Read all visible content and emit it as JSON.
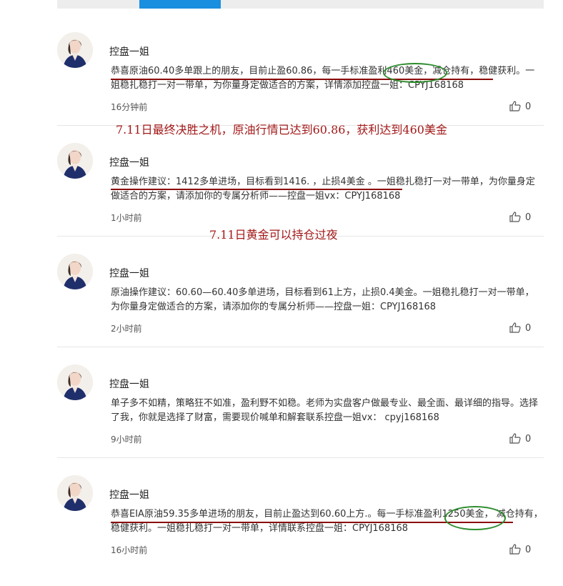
{
  "posts": [
    {
      "author": "控盘一姐",
      "content": "恭喜原油60.40多单跟上的朋友，目前止盈60.86，每一手标准盈利460美金，减仓持有，稳健获利。一姐稳扎稳打一对一带单，为你量身定做适合的方案，详情添加控盘一姐：CPYJ168168",
      "time": "16分钟前",
      "likes": "0"
    },
    {
      "author": "控盘一姐",
      "content": "黄金操作建议：1412多单进场，目标看到1416. ，止损4美金 。一姐稳扎稳打一对一带单，为你量身定做适合的方案，请添加你的专属分析师——控盘一姐vx：CPYJ168168",
      "time": "1小时前",
      "likes": "0"
    },
    {
      "author": "控盘一姐",
      "content": "原油操作建议：60.60—60.40多单进场，目标看到61上方，止损0.4美金。一姐稳扎稳打一对一带单，为你量身定做适合的方案，请添加你的专属分析师——控盘一姐：CPYJ168168",
      "time": "2小时前",
      "likes": "0"
    },
    {
      "author": "控盘一姐",
      "content": "单子多不如精，策略狂不如准，盈利野不如稳。老师为实盘客户做最专业、最全面、最详细的指导。选择了我，你就是选择了财富，需要现价喊单和解套联系控盘一姐vx： cpyj168168",
      "time": "9小时前",
      "likes": "0"
    },
    {
      "author": "控盘一姐",
      "content": "恭喜EIA原油59.35多单进场的朋友，目前止盈达到60.60上方.。每一手标准盈利1250美金， 减仓持有，稳健获利。一姐稳扎稳打一对一带单，详情联系控盘一姐：CPYJ168168",
      "time": "16小时前",
      "likes": "0"
    }
  ],
  "annotations": {
    "note1": "7.11日最终决胜之机，原油行情已达到60.86，获利达到460美金",
    "note2": "7.11日黄金可以持仓过夜"
  },
  "colors": {
    "accent_tab": "#1a8fe0",
    "annotation_red": "#8b0a0a",
    "annotation_green": "#2c8c2c"
  },
  "icons": {
    "like": "thumbs-up-icon",
    "avatar": "avatar-portrait"
  }
}
